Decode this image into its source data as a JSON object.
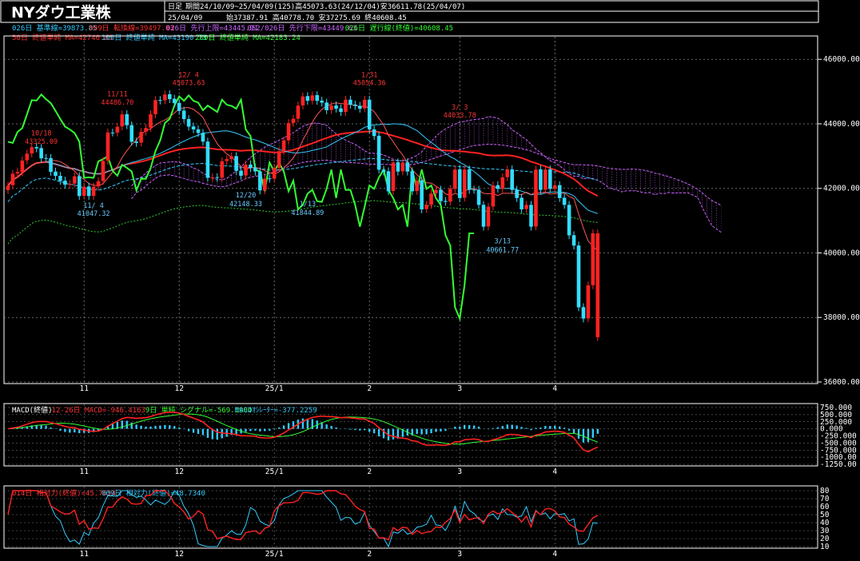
{
  "header": {
    "title": "NYダウ工業株",
    "period_label": "日足",
    "period_info": "期間24/10/09~25/04/09(125)高45073.63(24/12/04)安36611.78(25/04/07)",
    "date": "25/04/09",
    "ohlc": "始37387.91 高40778.70 安37275.69 終40608.45"
  },
  "legend": {
    "line1": [
      {
        "text": "026日 基準線=39873.85",
        "color": "#33ccff"
      },
      {
        "text": "009日 転換線=39497.03",
        "color": "#ff3333"
      },
      {
        "text": "026日 先行上限=43445.91",
        "color": "#cc66ff"
      },
      {
        "text": "052/026日 先行下限=43449.63",
        "color": "#cc66ff"
      },
      {
        "text": "026日 遅行線(終値)=40608.45",
        "color": "#33ff33"
      }
    ],
    "line2": [
      {
        "text": "50日 終値単純 MA=42746.85",
        "color": "#ff3333"
      },
      {
        "text": "100日 終値単純 MA=43190.73",
        "color": "#33ccff"
      },
      {
        "text": "200日 終値単純 MA=42183.24",
        "color": "#33ff33"
      }
    ]
  },
  "macd_legend": [
    {
      "text": "MACD(終値)",
      "color": "#ffffff"
    },
    {
      "text": "12-26日 MACD=-946.4163",
      "color": "#ff3333"
    },
    {
      "text": "9日 単純 シグナル=-569.1904",
      "color": "#33ff33"
    },
    {
      "text": "MACDｵｼﾚｰﾀｰ=-377.2259",
      "color": "#33ccff"
    }
  ],
  "rsi_legend": [
    {
      "text": "014日 相対力(終値)=45.7654",
      "color": "#ff3333"
    },
    {
      "text": "009日 相対力(終値)=48.7340",
      "color": "#33ccff"
    }
  ],
  "x_ticks": [
    {
      "label": "11",
      "i": 16
    },
    {
      "label": "12",
      "i": 36
    },
    {
      "label": "25/1",
      "i": 56
    },
    {
      "label": "2",
      "i": 76
    },
    {
      "label": "3",
      "i": 95
    },
    {
      "label": "4",
      "i": 115
    }
  ],
  "price_ticks": [
    "46000.00",
    "44000.00",
    "42000.00",
    "40000.00",
    "38000.00",
    "36000.00"
  ],
  "macd_ticks": [
    "750.000",
    "500.000",
    "250.000",
    "0.000",
    "-250.000",
    "-500.000",
    "-750.000",
    "-1000.00",
    "-1250.00"
  ],
  "rsi_ticks": [
    "80",
    "70",
    "60",
    "50",
    "40",
    "30",
    "20",
    "10"
  ],
  "annotations": [
    {
      "text": "10/18",
      "i": 7,
      "price": 43640,
      "color": "#ff3333"
    },
    {
      "text": "43325.09",
      "i": 7,
      "price": 43380,
      "color": "#ff3333"
    },
    {
      "text": "11/11",
      "i": 23,
      "price": 44850,
      "color": "#ff3333"
    },
    {
      "text": "44486.70",
      "i": 23,
      "price": 44600,
      "color": "#ff3333"
    },
    {
      "text": "12/ 4",
      "i": 38,
      "price": 45450,
      "color": "#ff3333"
    },
    {
      "text": "45073.63",
      "i": 38,
      "price": 45200,
      "color": "#ff3333"
    },
    {
      "text": "1/31",
      "i": 76,
      "price": 45450,
      "color": "#ff3333"
    },
    {
      "text": "45054.36",
      "i": 76,
      "price": 45200,
      "color": "#ff3333"
    },
    {
      "text": "3/ 3",
      "i": 95,
      "price": 44450,
      "color": "#ff3333"
    },
    {
      "text": "44033.78",
      "i": 95,
      "price": 44200,
      "color": "#ff3333"
    },
    {
      "text": "12/20",
      "i": 50,
      "price": 41720,
      "color": "#66ccff"
    },
    {
      "text": "42148.33",
      "i": 50,
      "price": 41450,
      "color": "#66ccff"
    },
    {
      "text": "1/13",
      "i": 63,
      "price": 41450,
      "color": "#66ccff"
    },
    {
      "text": "41844.89",
      "i": 63,
      "price": 41180,
      "color": "#66ccff"
    },
    {
      "text": "3/13",
      "i": 104,
      "price": 40300,
      "color": "#66ccff"
    },
    {
      "text": "40661.77",
      "i": 104,
      "price": 40020,
      "color": "#66ccff"
    },
    {
      "text": "11/ 4",
      "i": 18,
      "price": 41400,
      "color": "#66ccff"
    },
    {
      "text": "41047.32",
      "i": 18,
      "price": 41150,
      "color": "#66ccff"
    }
  ],
  "chart_data": [
    {
      "type": "candlestick",
      "title": "NYダウ工業株",
      "ylim": [
        36000,
        46600
      ],
      "x_count": 125,
      "close": [
        42080,
        42454,
        42512,
        42863,
        43077,
        43275,
        43239,
        42932,
        42931,
        42514,
        42387,
        42232,
        42114,
        42141,
        42374,
        41763,
        42052,
        41763,
        42053,
        42221,
        42853,
        43730,
        43729,
        43910,
        44293,
        43958,
        43444,
        43408,
        43750,
        43870,
        44296,
        44736,
        44722,
        44910,
        44765,
        44642,
        44401,
        44149,
        43914,
        43828,
        43717,
        43449,
        42327,
        42342,
        42326,
        42840,
        42906,
        42992,
        42544,
        42392,
        42732,
        42635,
        42526,
        41938,
        42300,
        42297,
        42635,
        43153,
        43488,
        44025,
        44157,
        44566,
        44850,
        44714,
        44882,
        44713,
        44656,
        44422,
        44566,
        44470,
        44368,
        44748,
        44593,
        44556,
        44470,
        44747,
        43828,
        43621,
        42579,
        42520,
        41911,
        42801,
        42521,
        42802,
        42520,
        41911,
        42240,
        41350,
        41488,
        41840,
        41954,
        41604,
        41582,
        41985,
        42583,
        41700,
        42583,
        41953,
        41954,
        41488,
        40813,
        41433,
        42091,
        41985,
        42342,
        42583,
        41954,
        41700,
        41350,
        41488,
        40813,
        42583,
        41953,
        42583,
        41985,
        42091,
        41700,
        41488,
        40545,
        40228,
        38314,
        37966,
        38997,
        40608,
        40608
      ],
      "open": [
        41950,
        42100,
        42460,
        42500,
        42870,
        43080,
        43280,
        43250,
        42940,
        42940,
        42520,
        42390,
        42240,
        42120,
        42150,
        42380,
        41770,
        42060,
        41770,
        42060,
        42230,
        42860,
        43730,
        43730,
        43920,
        44300,
        43960,
        43450,
        43420,
        43760,
        43880,
        44300,
        44740,
        44730,
        44920,
        44780,
        44650,
        44410,
        44150,
        43920,
        43830,
        43720,
        43450,
        42330,
        42350,
        42330,
        42850,
        42910,
        43000,
        42550,
        42400,
        42740,
        42640,
        42530,
        41940,
        42310,
        42300,
        42640,
        43160,
        43490,
        44030,
        44160,
        44570,
        44860,
        44720,
        44890,
        44720,
        44660,
        44430,
        44570,
        44480,
        44370,
        44750,
        44600,
        44560,
        44480,
        44750,
        43830,
        43630,
        42580,
        42530,
        41920,
        42810,
        42530,
        42810,
        42530,
        41920,
        42250,
        41360,
        41490,
        41850,
        41960,
        41610,
        41590,
        41990,
        42590,
        41710,
        42590,
        41960,
        41960,
        41490,
        40820,
        41440,
        42100,
        41990,
        42350,
        42590,
        41960,
        41710,
        41360,
        41490,
        40820,
        42590,
        41960,
        42590,
        41990,
        42100,
        41710,
        41490,
        40550,
        40230,
        38320,
        37970,
        39000,
        37388
      ]
    },
    {
      "type": "line",
      "title": "MACD(終値)",
      "ylim": [
        -1250,
        750
      ],
      "series": [
        {
          "name": "12-26日 MACD",
          "color": "#ff3333"
        },
        {
          "name": "9日 単純 シグナル",
          "color": "#33ff33"
        },
        {
          "name": "MACDｵｼﾚｰﾀｰ",
          "color": "#33ccff"
        }
      ]
    },
    {
      "type": "line",
      "title": "相対力",
      "ylim": [
        10,
        80
      ],
      "series": [
        {
          "name": "014日 相対力(終値)",
          "color": "#ff3333"
        },
        {
          "name": "009日 相対力(終値)",
          "color": "#33ccff"
        }
      ]
    }
  ]
}
